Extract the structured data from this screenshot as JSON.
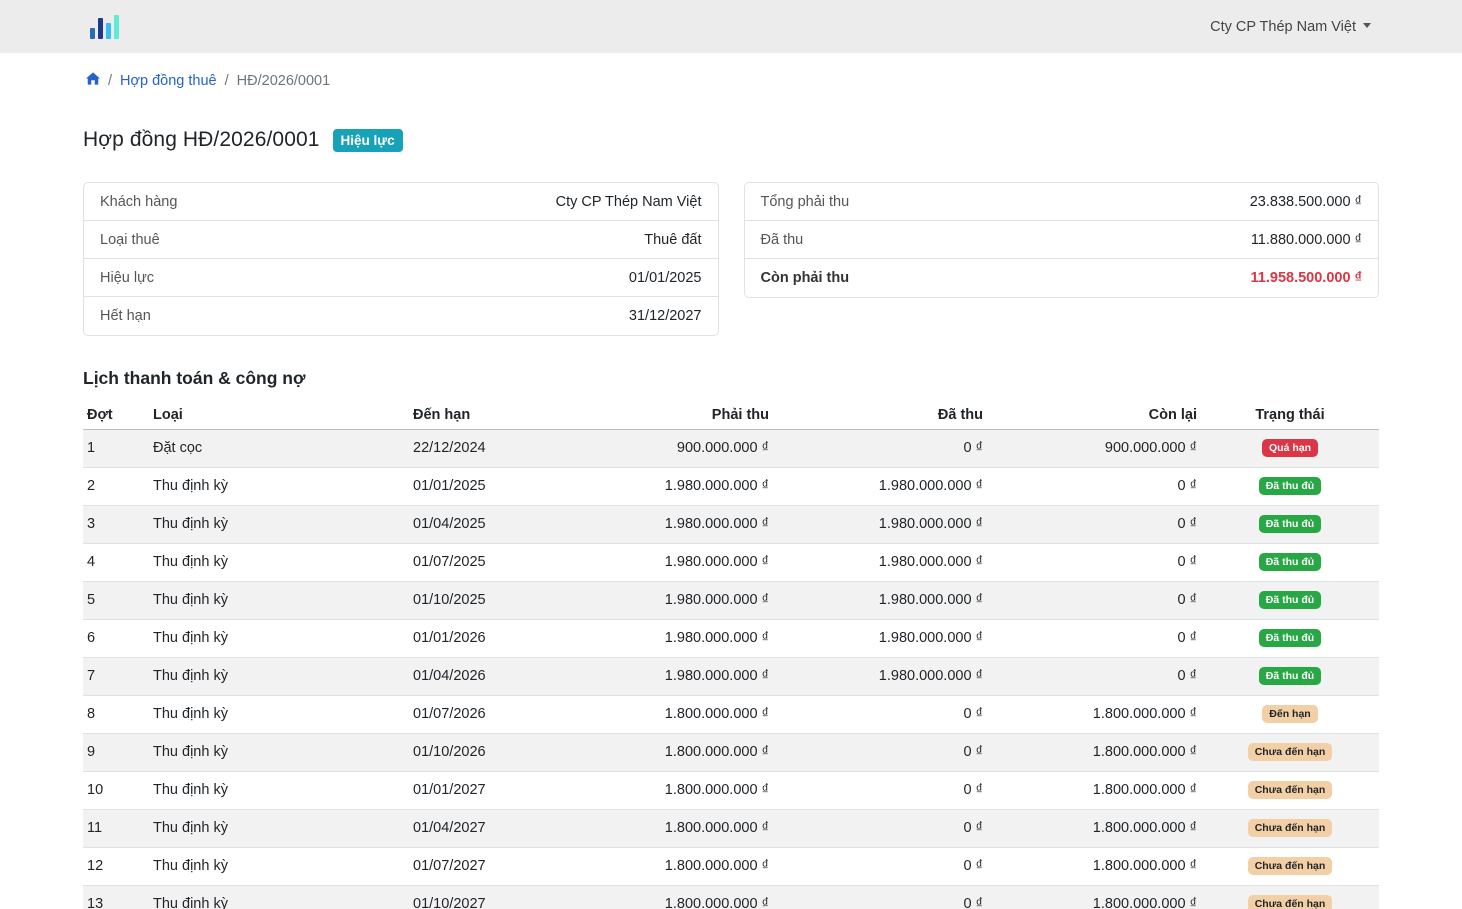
{
  "navbar": {
    "user_label": "Cty CP Thép Nam Việt"
  },
  "breadcrumb": {
    "parent": "Hợp đồng thuê",
    "current": "HĐ/2026/0001",
    "separator": "/"
  },
  "page": {
    "title": "Hợp đồng HĐ/2026/0001",
    "status": "Hiệu lực"
  },
  "info_card": [
    {
      "label": "Khách hàng",
      "value": "Cty CP Thép Nam Việt"
    },
    {
      "label": "Loại thuê",
      "value": "Thuê đất"
    },
    {
      "label": "Hiệu lực",
      "value": "01/01/2025"
    },
    {
      "label": "Hết hạn",
      "value": "31/12/2027"
    }
  ],
  "finance_card": [
    {
      "label": "Tổng phải thu",
      "value": "23.838.500.000 ₫"
    },
    {
      "label": "Đã thu",
      "value": "11.880.000.000 ₫"
    },
    {
      "label": "Còn phải thu",
      "value": "11.958.500.000 ₫"
    }
  ],
  "schedule": {
    "title": "Lịch thanh toán & công nợ",
    "headers": [
      "Đợt",
      "Loại",
      "Đến hạn",
      "Phải thu",
      "Đã thu",
      "Còn lại",
      "Trạng thái"
    ],
    "rows": [
      {
        "no": "1",
        "type": "Đặt cọc",
        "due": "22/12/2024",
        "receivable": "900.000.000 ₫",
        "paid": "0 ₫",
        "remaining": "900.000.000 ₫",
        "status": "Quá hạn",
        "status_color": "#dc3545"
      },
      {
        "no": "2",
        "type": "Thu định kỳ",
        "due": "01/01/2025",
        "receivable": "1.980.000.000 ₫",
        "paid": "1.980.000.000 ₫",
        "remaining": "0 ₫",
        "status": "Đã thu đủ",
        "status_color": "#28a745"
      },
      {
        "no": "3",
        "type": "Thu định kỳ",
        "due": "01/04/2025",
        "receivable": "1.980.000.000 ₫",
        "paid": "1.980.000.000 ₫",
        "remaining": "0 ₫",
        "status": "Đã thu đủ",
        "status_color": "#28a745"
      },
      {
        "no": "4",
        "type": "Thu định kỳ",
        "due": "01/07/2025",
        "receivable": "1.980.000.000 ₫",
        "paid": "1.980.000.000 ₫",
        "remaining": "0 ₫",
        "status": "Đã thu đủ",
        "status_color": "#28a745"
      },
      {
        "no": "5",
        "type": "Thu định kỳ",
        "due": "01/10/2025",
        "receivable": "1.980.000.000 ₫",
        "paid": "1.980.000.000 ₫",
        "remaining": "0 ₫",
        "status": "Đã thu đủ",
        "status_color": "#28a745"
      },
      {
        "no": "6",
        "type": "Thu định kỳ",
        "due": "01/01/2026",
        "receivable": "1.980.000.000 ₫",
        "paid": "1.980.000.000 ₫",
        "remaining": "0 ₫",
        "status": "Đã thu đủ",
        "status_color": "#28a745"
      },
      {
        "no": "7",
        "type": "Thu định kỳ",
        "due": "01/04/2026",
        "receivable": "1.980.000.000 ₫",
        "paid": "1.980.000.000 ₫",
        "remaining": "0 ₫",
        "status": "Đã thu đủ",
        "status_color": "#28a745"
      },
      {
        "no": "8",
        "type": "Thu định kỳ",
        "due": "01/07/2026",
        "receivable": "1.800.000.000 ₫",
        "paid": "0 ₫",
        "remaining": "1.800.000.000 ₫",
        "status": "Đến hạn",
        "status_color": "#f3cfa6"
      },
      {
        "no": "9",
        "type": "Thu định kỳ",
        "due": "01/10/2026",
        "receivable": "1.800.000.000 ₫",
        "paid": "0 ₫",
        "remaining": "1.800.000.000 ₫",
        "status": "Chưa đến hạn",
        "status_color": "#f3cfa6"
      },
      {
        "no": "10",
        "type": "Thu định kỳ",
        "due": "01/01/2027",
        "receivable": "1.800.000.000 ₫",
        "paid": "0 ₫",
        "remaining": "1.800.000.000 ₫",
        "status": "Chưa đến hạn",
        "status_color": "#f3cfa6"
      },
      {
        "no": "11",
        "type": "Thu định kỳ",
        "due": "01/04/2027",
        "receivable": "1.800.000.000 ₫",
        "paid": "0 ₫",
        "remaining": "1.800.000.000 ₫",
        "status": "Chưa đến hạn",
        "status_color": "#f3cfa6"
      },
      {
        "no": "12",
        "type": "Thu định kỳ",
        "due": "01/07/2027",
        "receivable": "1.800.000.000 ₫",
        "paid": "0 ₫",
        "remaining": "1.800.000.000 ₫",
        "status": "Chưa đến hạn",
        "status_color": "#f3cfa6"
      },
      {
        "no": "13",
        "type": "Thu định kỳ",
        "due": "01/10/2027",
        "receivable": "1.800.000.000 ₫",
        "paid": "0 ₫",
        "remaining": "1.800.000.000 ₫",
        "status": "Chưa đến hạn",
        "status_color": "#f3cfa6"
      }
    ]
  },
  "icons": {
    "logo": "bar-chart-logo-icon",
    "home": "home-icon",
    "dropdown": "caret-down-icon"
  }
}
